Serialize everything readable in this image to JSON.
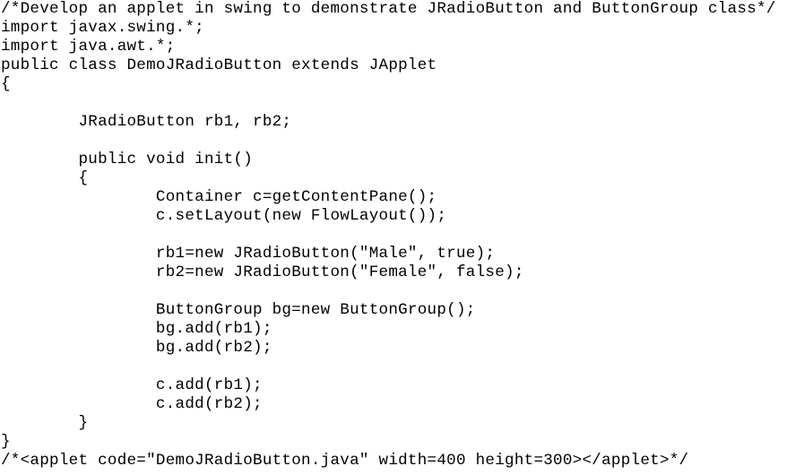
{
  "code_lines": [
    "/*Develop an applet in swing to demonstrate JRadioButton and ButtonGroup class*/",
    "import javax.swing.*;",
    "import java.awt.*;",
    "public class DemoJRadioButton extends JApplet",
    "{",
    "",
    "        JRadioButton rb1, rb2;",
    "",
    "        public void init()",
    "        {",
    "                Container c=getContentPane();",
    "                c.setLayout(new FlowLayout());",
    "",
    "                rb1=new JRadioButton(\"Male\", true);",
    "                rb2=new JRadioButton(\"Female\", false);",
    "",
    "                ButtonGroup bg=new ButtonGroup();",
    "                bg.add(rb1);",
    "                bg.add(rb2);",
    "",
    "                c.add(rb1);",
    "                c.add(rb2);",
    "        }",
    "}",
    "/*<applet code=\"DemoJRadioButton.java\" width=400 height=300></applet>*/"
  ]
}
